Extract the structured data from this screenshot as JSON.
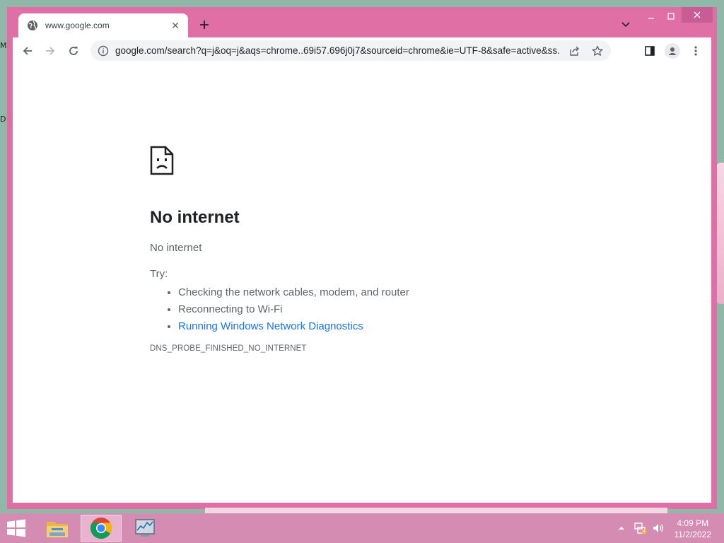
{
  "tab": {
    "title": "www.google.com"
  },
  "omnibox": {
    "url": "google.com/search?q=j&oq=j&aqs=chrome..69i57.696j0j7&sourceid=chrome&ie=UTF-8&safe=active&ss..."
  },
  "error": {
    "heading": "No internet",
    "subheading": "No internet",
    "try_label": "Try:",
    "suggestions": [
      "Checking the network cables, modem, and router",
      "Reconnecting to Wi-Fi",
      "Running Windows Network Diagnostics"
    ],
    "code": "DNS_PROBE_FINISHED_NO_INTERNET"
  },
  "desktop": {
    "glyph_1": "M",
    "glyph_2": "D"
  },
  "clock": {
    "time": "4:09 PM",
    "date": "11/2/2022"
  },
  "icons": {
    "tab": "globe-icon",
    "nav": [
      "back-arrow-icon",
      "forward-arrow-icon",
      "reload-icon"
    ],
    "omnibox": [
      "info-icon",
      "share-icon",
      "bookmark-star-icon"
    ],
    "toolbar": [
      "side-panel-icon",
      "profile-icon",
      "menu-dots-icon"
    ],
    "error": "sad-document-icon",
    "taskbar": [
      "windows-start-icon",
      "file-explorer-icon",
      "chrome-icon",
      "performance-monitor-icon"
    ],
    "tray": [
      "show-hidden-icons-icon",
      "network-icon",
      "volume-icon"
    ]
  },
  "colors": {
    "window_frame": "#df6fa5",
    "taskbar": "#d58cb2",
    "link": "#1a73e8"
  }
}
